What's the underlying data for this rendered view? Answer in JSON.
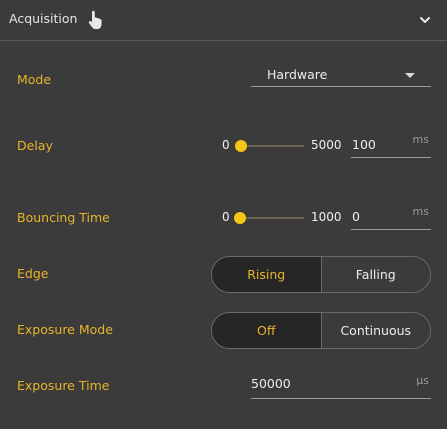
{
  "header": {
    "title": "Acquisition",
    "icon": "hand-pointer-icon",
    "collapse_icon": "chevron-down-icon"
  },
  "fields": {
    "mode": {
      "label": "Mode",
      "value": "Hardware"
    },
    "delay": {
      "label": "Delay",
      "min": "0",
      "max": "5000",
      "value": "100",
      "unit": "ms",
      "slider_fraction": 0.02
    },
    "bouncing_time": {
      "label": "Bouncing Time",
      "min": "0",
      "max": "1000",
      "value": "0",
      "unit": "ms",
      "slider_fraction": 0
    },
    "edge": {
      "label": "Edge",
      "options": [
        "Rising",
        "Falling"
      ],
      "selected": "Rising"
    },
    "exposure_mode": {
      "label": "Exposure Mode",
      "options": [
        "Off",
        "Continuous"
      ],
      "selected": "Off"
    },
    "exposure_time": {
      "label": "Exposure Time",
      "value": "50000",
      "unit": "µs"
    }
  },
  "colors": {
    "accent": "#e8b42a",
    "thumb": "#f5c518",
    "background": "#3b3b3b",
    "active_toggle_bg": "#262626"
  }
}
